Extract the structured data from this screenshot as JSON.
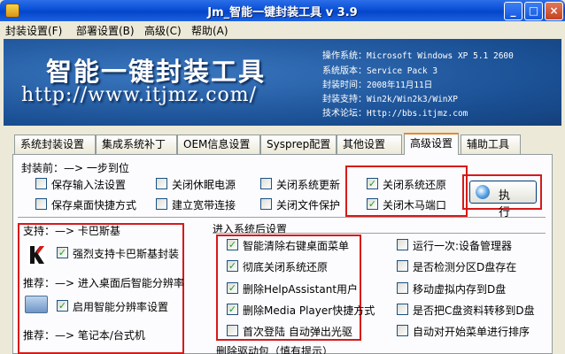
{
  "window": {
    "title": "Jm_智能一键封装工具 v 3.9",
    "controls": {
      "minimize": "_",
      "maximize": "□",
      "close": "×"
    }
  },
  "menu": [
    "封装设置(F)",
    "部署设置(B)",
    "高级(C)",
    "帮助(A)"
  ],
  "banner": {
    "title": "智能一键封装工具",
    "url": "http://www.itjmz.com/",
    "info": [
      {
        "label": "操作系统：",
        "value": "Microsoft Windows XP 5.1 2600"
      },
      {
        "label": "系统版本：",
        "value": "Service Pack 3"
      },
      {
        "label": "封装时间：",
        "value": "2008年11月11日"
      },
      {
        "label": "封装支持：",
        "value": "Win2k/Win2k3/WinXP"
      },
      {
        "label": "技术论坛：",
        "value": "Http://bbs.itjmz.com"
      }
    ]
  },
  "tabs": [
    "系统封装设置",
    "集成系统补丁",
    "OEM信息设置",
    "Sysprep配置",
    "其他设置",
    "高级设置",
    "辅助工具"
  ],
  "active_tab": "高级设置",
  "pre_section": {
    "title": "封装前：—> 一步到位",
    "items": [
      {
        "label": "保存输入法设置",
        "checked": false
      },
      {
        "label": "关闭休眠电源",
        "checked": false
      },
      {
        "label": "关闭系统更新",
        "checked": false
      },
      {
        "label": "关闭系统还原",
        "checked": true
      },
      {
        "label": "保存桌面快捷方式",
        "checked": false
      },
      {
        "label": "建立宽带连接",
        "checked": false
      },
      {
        "label": "关闭文件保护",
        "checked": false
      },
      {
        "label": "关闭木马端口",
        "checked": true
      }
    ]
  },
  "exec_button": {
    "label": "执 行"
  },
  "left_groups": {
    "support_title": "支持：—> 卡巴斯基",
    "kaspersky": {
      "label": "强烈支持卡巴斯基封装",
      "checked": true
    },
    "recommend_title": "推荐：—> 进入桌面后智能分辨率",
    "resolution": {
      "label": "启用智能分辨率设置",
      "checked": true
    },
    "notebook_title": "推荐：—> 笔记本/台式机"
  },
  "enter_system": {
    "title": "进入系统后设置",
    "left": [
      {
        "label": "智能清除右键桌面菜单",
        "checked": true
      },
      {
        "label": "彻底关闭系统还原",
        "checked": true
      },
      {
        "label": "删除HelpAssistant用户",
        "checked": true
      },
      {
        "label": "删除Media Player快捷方式",
        "checked": true
      },
      {
        "label": "首次登陆 自动弹出光驱",
        "checked": false
      }
    ],
    "right": [
      {
        "label": "运行一次:设备管理器",
        "checked": false
      },
      {
        "label": "是否检测分区D盘存在",
        "checked": false
      },
      {
        "label": "移动虚拟内存到D盘",
        "checked": false
      },
      {
        "label": "是否把C盘资料转移到D盘",
        "checked": false
      },
      {
        "label": "自动对开始菜单进行排序",
        "checked": false
      }
    ]
  },
  "driver_section": {
    "title": "删除驱动包（慎有提示）"
  },
  "colors": {
    "titlebar": "#0a4fd6",
    "banner": "#1a4f93",
    "highlight_box": "#d61a1a",
    "tab_accent": "#e68b2c"
  }
}
